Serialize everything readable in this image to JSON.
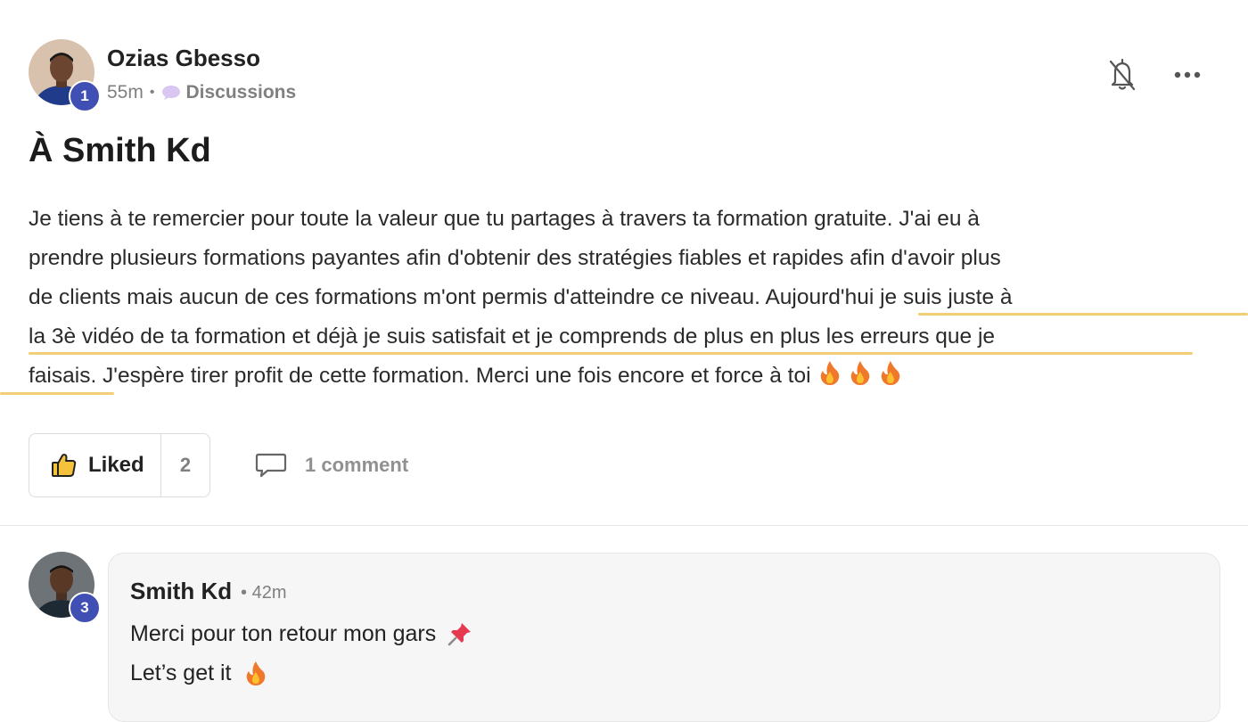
{
  "post": {
    "author": {
      "name": "Ozias Gbesso",
      "level": "1"
    },
    "time": "55m",
    "separator": "•",
    "category": "Discussions",
    "title": "À Smith Kd",
    "body_lines": [
      "Je tiens à te remercier pour toute la valeur que tu partages à travers ta formation gratuite. J'ai eu à",
      "prendre plusieurs formations payantes afin d'obtenir des stratégies fiables et rapides afin d'avoir plus",
      "de clients mais aucun de ces formations m'ont permis d'atteindre ce niveau. Aujourd'hui je suis juste à",
      "la 3è vidéo de ta formation et déjà je suis satisfait et je comprends de plus en plus les erreurs que je",
      "faisais. J'espère tirer profit de cette formation. Merci une fois encore et force à toi"
    ],
    "like_label": "Liked",
    "like_count": "2",
    "comment_label": "1 comment",
    "icons": [
      "bell-off-icon",
      "more-icon",
      "speech-bubble-icon",
      "thumbs-up-icon",
      "comment-icon",
      "fire-emoji"
    ]
  },
  "comment": {
    "author": {
      "name": "Smith Kd",
      "level": "3"
    },
    "separator": "•",
    "time": "42m",
    "lines": [
      "Merci pour ton retour mon gars",
      "Let’s get it"
    ],
    "icons": [
      "pushpin-emoji",
      "fire-emoji"
    ]
  },
  "colors": {
    "highlight_underline": "#f2cf77",
    "level_badge": "#3f4fb3",
    "muted_text": "#808080",
    "comment_bg": "#f6f6f6"
  }
}
